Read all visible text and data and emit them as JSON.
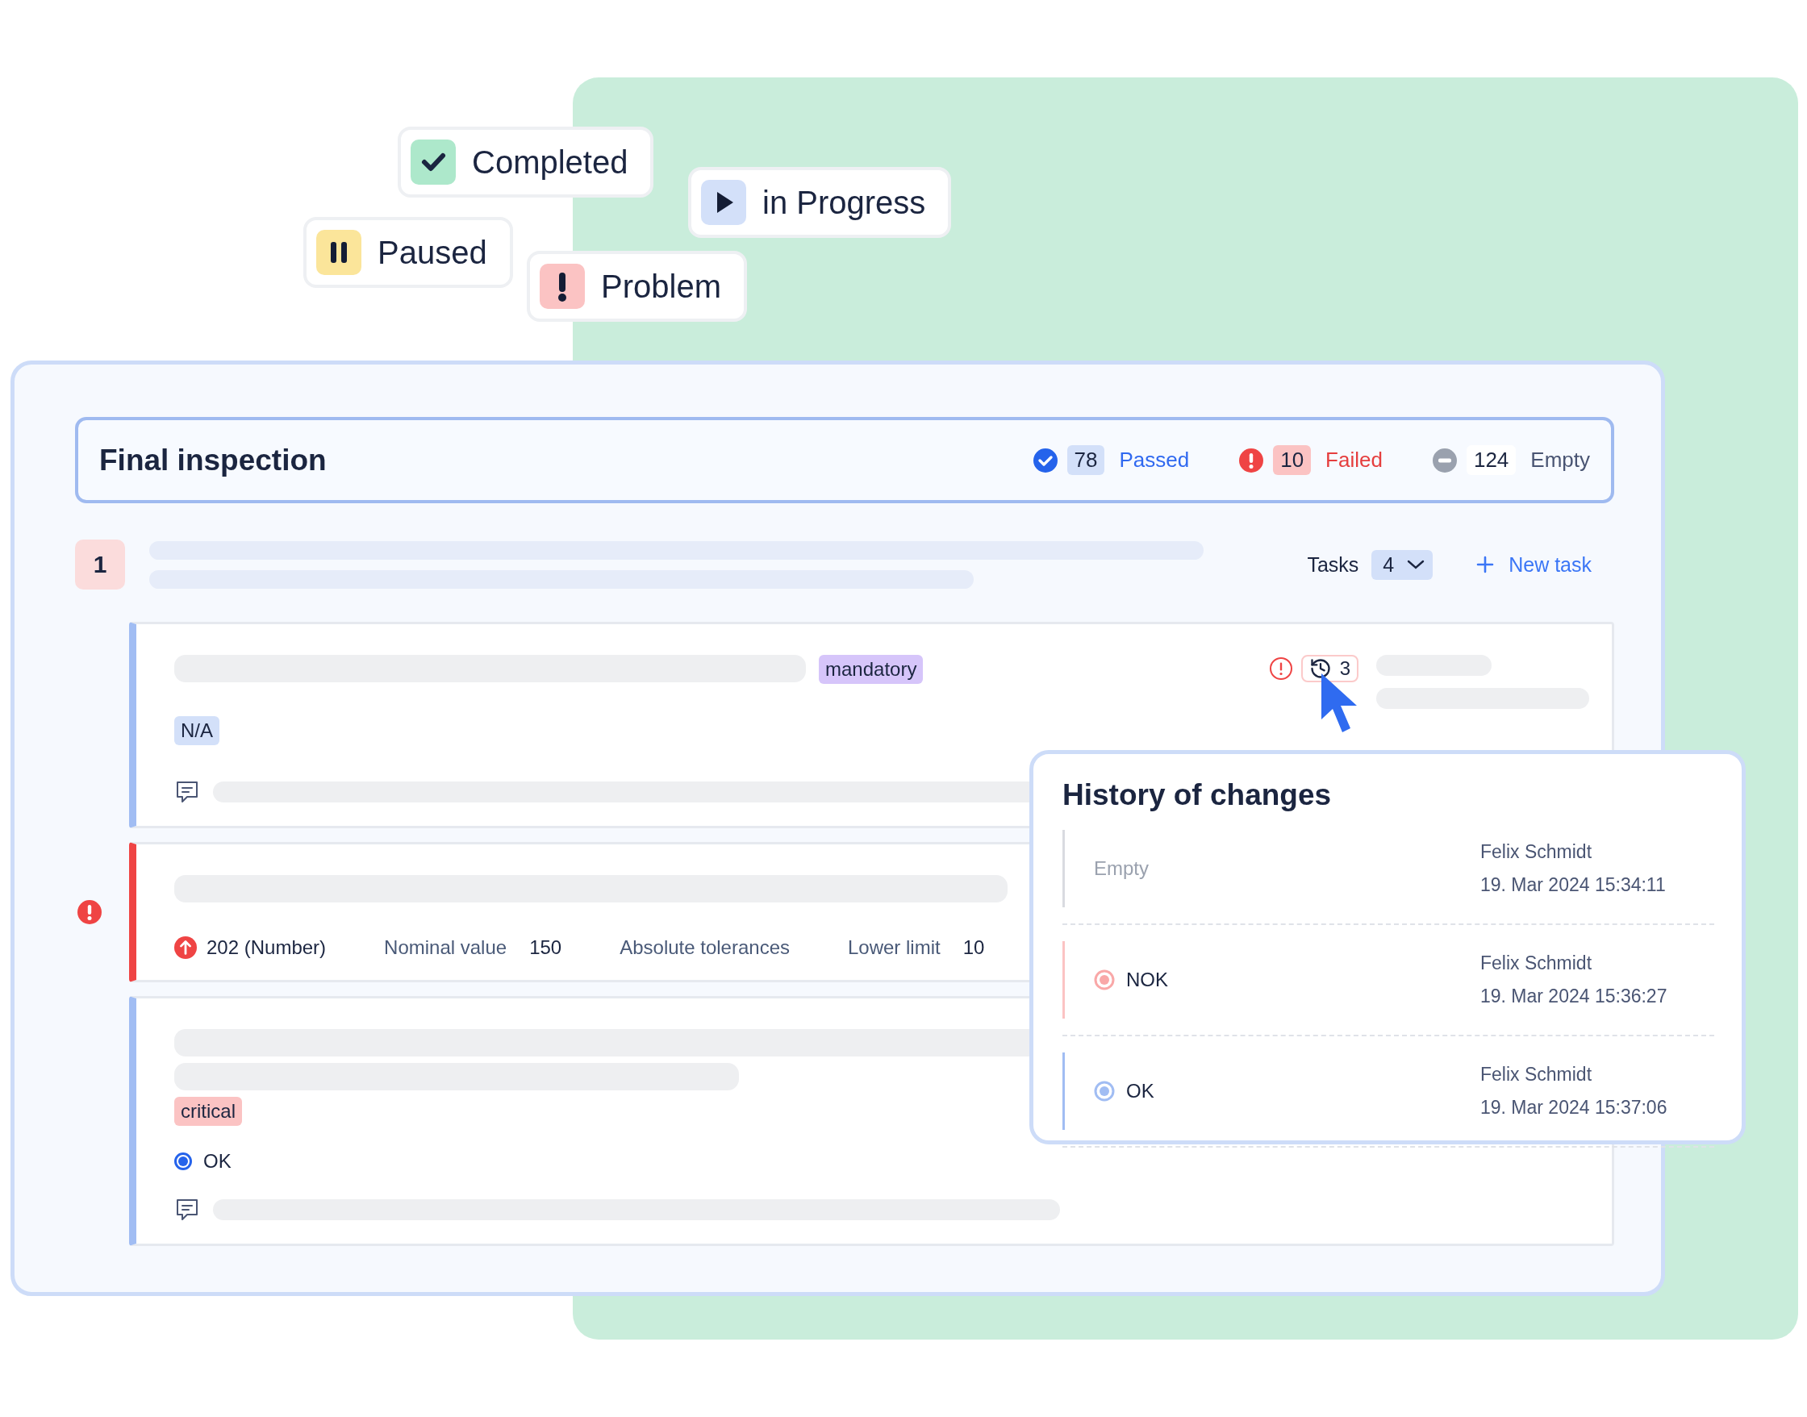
{
  "status_chips": [
    {
      "kind": "completed",
      "label": "Completed"
    },
    {
      "kind": "progress",
      "label": "in Progress"
    },
    {
      "kind": "paused",
      "label": "Paused"
    },
    {
      "kind": "problem",
      "label": "Problem"
    }
  ],
  "inspection": {
    "title": "Final inspection",
    "stats": [
      {
        "kind": "passed",
        "count": "78",
        "label": "Passed"
      },
      {
        "kind": "failed",
        "count": "10",
        "label": "Failed"
      },
      {
        "kind": "empty",
        "count": "124",
        "label": "Empty"
      }
    ]
  },
  "section": {
    "number": "1",
    "tasks_label": "Tasks",
    "tasks_count": "4",
    "new_task": "New task"
  },
  "tasks": [
    {
      "error": false,
      "tag": {
        "kind": "mandatory",
        "label": "mandatory"
      },
      "history_count": "3",
      "answer": {
        "kind": "chip",
        "label": "N/A"
      },
      "comment": true
    },
    {
      "error": true,
      "measurement": {
        "value": "202 (Number)",
        "fields": [
          {
            "label": "Nominal value",
            "value": "150"
          },
          {
            "label": "Absolute tolerances"
          },
          {
            "label": "Lower limit",
            "value": "10"
          }
        ]
      }
    },
    {
      "error": false,
      "tag": {
        "kind": "critical",
        "label": "critical"
      },
      "answer": {
        "kind": "radio",
        "label": "OK",
        "selected": true
      },
      "comment": true
    }
  ],
  "history": {
    "title": "History of changes",
    "entries": [
      {
        "kind": "empty",
        "value": "Empty",
        "author": "Felix Schmidt",
        "time": "19. Mar 2024 15:34:11"
      },
      {
        "kind": "nok",
        "value": "NOK",
        "author": "Felix Schmidt",
        "time": "19. Mar 2024 15:36:27"
      },
      {
        "kind": "ok",
        "value": "OK",
        "author": "Felix Schmidt",
        "time": "19. Mar 2024 15:37:06"
      }
    ]
  }
}
